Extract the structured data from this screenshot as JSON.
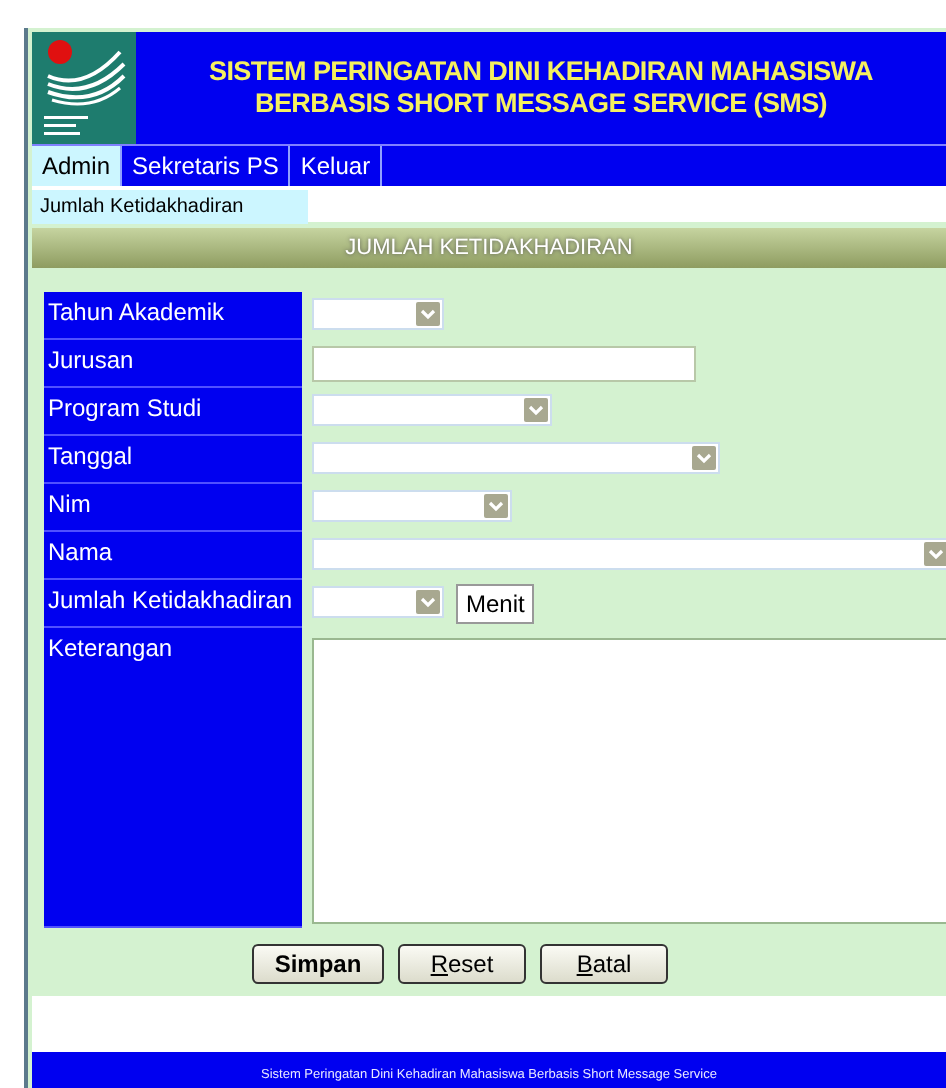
{
  "header": {
    "title_lines": [
      "SISTEM PERINGATAN DINI KEHADIRAN MAHASISWA",
      "BERBASIS SHORT MESSAGE SERVICE (SMS)"
    ]
  },
  "menu": [
    {
      "label": "Admin",
      "selected": true
    },
    {
      "label": "Sekretaris PS",
      "selected": false
    },
    {
      "label": "Keluar",
      "selected": false
    }
  ],
  "submenu": [
    {
      "label": "Jumlah Ketidakhadiran"
    }
  ],
  "section_title": "JUMLAH KETIDAKHADIRAN",
  "form": [
    {
      "label": "Tahun Akademik",
      "kind": "select"
    },
    {
      "label": "Jurusan",
      "kind": "input"
    },
    {
      "label": "Program Studi",
      "kind": "select"
    },
    {
      "label": "Tanggal",
      "kind": "select"
    },
    {
      "label": "Nim",
      "kind": "select"
    },
    {
      "label": "Nama",
      "kind": "select"
    },
    {
      "label": "Jumlah Ketidakhadiran",
      "kind": "select",
      "unit": "Menit"
    },
    {
      "label": "Keterangan",
      "kind": "textarea"
    }
  ],
  "buttons": [
    {
      "label": "Simpan",
      "default": true,
      "mnemonic": false
    },
    {
      "label": "Reset",
      "default": false,
      "mnemonic": true
    },
    {
      "label": "Batal",
      "default": false,
      "mnemonic": true
    }
  ],
  "footer": "Sistem Peringatan Dini Kehadiran Mahasiswa Berbasis Short Message Service"
}
